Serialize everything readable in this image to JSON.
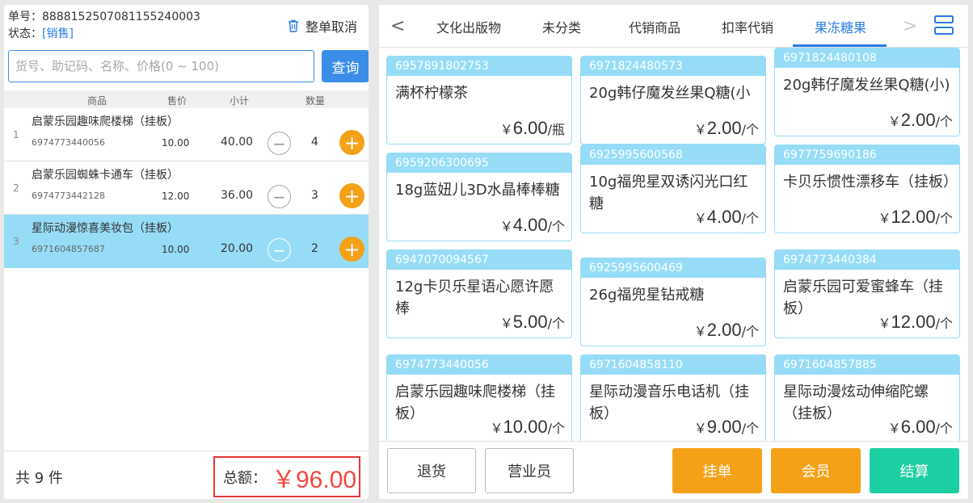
{
  "order": {
    "number_label": "单号：",
    "number": "8888152507081155240003",
    "status_label": "状态：",
    "status": "[销售]",
    "cancel_label": "整单取消"
  },
  "search": {
    "placeholder": "货号、助记码、名称、价格(0 ~ 100)",
    "button_label": "查询"
  },
  "table_headers": {
    "product": "商品",
    "price": "售价",
    "subtotal": "小计",
    "qty": "数量"
  },
  "cart_items": [
    {
      "index": "1",
      "name": "启蒙乐园趣味爬楼梯（挂板）",
      "code": "6974773440056",
      "price": "10.00",
      "subtotal": "40.00",
      "qty": "4"
    },
    {
      "index": "2",
      "name": "启蒙乐园蜘蛛卡通车（挂板）",
      "code": "6974773442128",
      "price": "12.00",
      "subtotal": "36.00",
      "qty": "3"
    },
    {
      "index": "3",
      "name": "星际动漫惊喜美妆包（挂板）",
      "code": "6971604857687",
      "price": "10.00",
      "subtotal": "20.00",
      "qty": "2"
    }
  ],
  "footer": {
    "count_text": "共 9 件",
    "total_label": "总额：",
    "total_value": "￥96.00"
  },
  "tabs": [
    "文化出版物",
    "未分类",
    "代销商品",
    "扣率代销",
    "果冻糖果"
  ],
  "active_tab": "果冻糖果",
  "products": [
    {
      "code": "6957891802753",
      "name": "满杯柠檬茶",
      "price": "6.00",
      "unit": "/瓶"
    },
    {
      "code": "6971824480573",
      "name": "20g韩仔魔发丝果Q糖(小",
      "price": "2.00",
      "unit": "/个"
    },
    {
      "code": "6971824480108",
      "name": "20g韩仔魔发丝果Q糖(小)",
      "price": "2.00",
      "unit": "/个"
    },
    {
      "code": "6959206300695",
      "name": "18g蓝妞儿3D水晶棒棒糖",
      "price": "4.00",
      "unit": "/个"
    },
    {
      "code": "6925995600568",
      "name": "10g福兜星双诱闪光口红糖",
      "price": "4.00",
      "unit": "/个"
    },
    {
      "code": "6977759690186",
      "name": "卡贝乐惯性漂移车（挂板）",
      "price": "12.00",
      "unit": "/个"
    },
    {
      "code": "6947070094567",
      "name": "12g卡贝乐星语心愿许愿棒",
      "price": "5.00",
      "unit": "/个"
    },
    {
      "code": "6925995600469",
      "name": "26g福兜星钻戒糖",
      "price": "2.00",
      "unit": "/个"
    },
    {
      "code": "6974773440384",
      "name": "启蒙乐园可爱蜜蜂车（挂板）",
      "price": "12.00",
      "unit": "/个"
    },
    {
      "code": "6974773440056",
      "name": "启蒙乐园趣味爬楼梯（挂板）",
      "price": "10.00",
      "unit": "/个"
    },
    {
      "code": "6971604858110",
      "name": "星际动漫音乐电话机（挂板）",
      "price": "9.00",
      "unit": "/个"
    },
    {
      "code": "6971604857885",
      "name": "星际动漫炫动伸缩陀螺（挂板）",
      "price": "6.00",
      "unit": "/个"
    }
  ],
  "yen": "￥",
  "actions": {
    "return": "退货",
    "clerk": "营业员",
    "hold": "挂单",
    "member": "会员",
    "checkout": "结算"
  },
  "colors": {
    "accent_blue": "#2a7be4",
    "selected_row": "#96dcf6",
    "orange": "#f5a118",
    "green": "#1ccfa3",
    "total_red": "#f2483f"
  }
}
